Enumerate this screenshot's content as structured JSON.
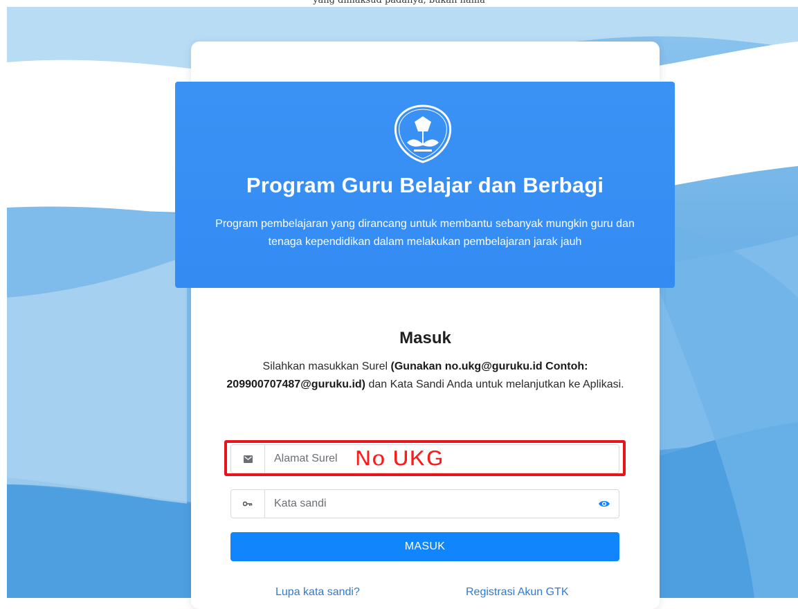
{
  "top_caption": "yang dimaksud padanya, bukan nama",
  "hero": {
    "logo_text": "TUT WURI HANDAYANI",
    "title": "Program Guru Belajar dan Berbagi",
    "description": "Program pembelajaran yang dirancang untuk membantu sebanyak mungkin guru dan tenaga kependidikan dalam melakukan pembelajaran jarak jauh"
  },
  "login": {
    "title": "Masuk",
    "desc_part1": "Silahkan masukkan Surel ",
    "desc_bold": "(Gunakan no.ukg@guruku.id Contoh: 209900707487@guruku.id)",
    "desc_part2": " dan Kata Sandi Anda untuk melanjutkan ke Aplikasi.",
    "email_icon": "envelope-icon",
    "email_placeholder": "Alamat Surel",
    "email_value": "",
    "password_icon": "key-icon",
    "password_placeholder": "Kata sandi",
    "password_value": "",
    "toggle_icon": "eye-icon",
    "submit_label": "MASUK",
    "forgot_label": "Lupa kata sandi?",
    "register_label": "Registrasi Akun GTK"
  },
  "annotation": {
    "text": "No UKG",
    "color": "#ff1a1a",
    "box_color": "#e8141c"
  },
  "colors": {
    "hero_bg": "#3a92f5",
    "button_bg": "#1185fb",
    "link": "#2f79d6"
  }
}
